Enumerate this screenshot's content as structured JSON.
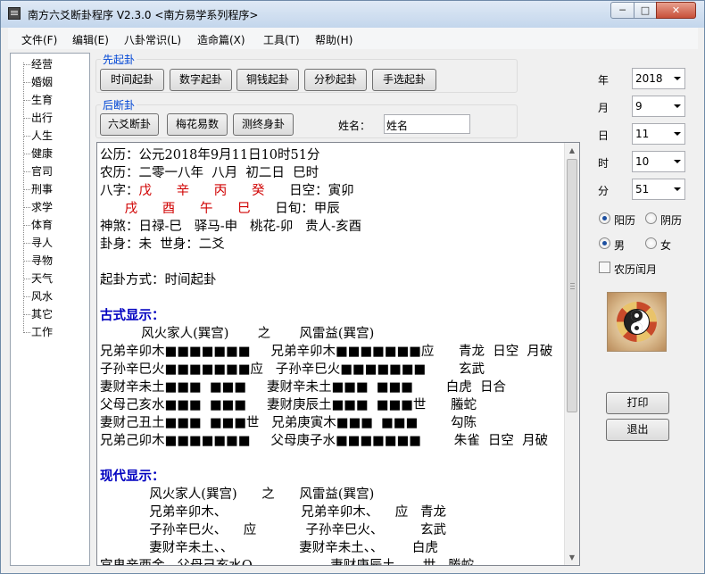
{
  "window": {
    "title": "南方六爻断卦程序 V2.3.0   <南方易学系列程序>"
  },
  "titlebar_buttons": {
    "minimize": "─",
    "maximize": "□",
    "close": "✕"
  },
  "menu": [
    "文件(F)",
    "编辑(E)",
    "八卦常识(L)",
    "造命篇(X)",
    "工具(T)",
    "帮助(H)"
  ],
  "sidebar": {
    "items": [
      "经营",
      "婚姻",
      "生育",
      "出行",
      "人生",
      "健康",
      "官司",
      "刑事",
      "求学",
      "体育",
      "寻人",
      "寻物",
      "天气",
      "风水",
      "其它",
      "工作"
    ]
  },
  "qigua": {
    "title": "先起卦",
    "buttons": [
      "时间起卦",
      "数字起卦",
      "铜钱起卦",
      "分秒起卦",
      "手选起卦"
    ]
  },
  "duangua": {
    "title": "后断卦",
    "buttons": [
      "六爻断卦",
      "梅花易数",
      "测终身卦"
    ],
    "name_label": "姓名：",
    "name_value": "姓名"
  },
  "output": {
    "lines": [
      {
        "segs": [
          {
            "t": "公历：公元2018年9月11日10时51分"
          }
        ]
      },
      {
        "segs": [
          {
            "t": "农历：二零一八年  八月  初二日  巳时"
          }
        ]
      },
      {
        "segs": [
          {
            "t": "八字："
          },
          {
            "t": "戊      辛      丙      癸",
            "c": "red"
          },
          {
            "t": "      日空：寅卯"
          }
        ]
      },
      {
        "segs": [
          {
            "t": "      "
          },
          {
            "t": "戌      酉      午      巳",
            "c": "red"
          },
          {
            "t": "      日旬：甲辰"
          }
        ]
      },
      {
        "segs": [
          {
            "t": "神煞：日禄-巳   驿马-申   桃花-卯   贵人-亥酉"
          }
        ]
      },
      {
        "segs": [
          {
            "t": "卦身：未  世身：二爻"
          }
        ]
      },
      {
        "segs": [
          {
            "t": ""
          }
        ]
      },
      {
        "segs": [
          {
            "t": "起卦方式：时间起卦"
          }
        ]
      },
      {
        "segs": [
          {
            "t": ""
          }
        ]
      },
      {
        "segs": [
          {
            "t": "古式显示：",
            "c": "blue-bold"
          }
        ]
      },
      {
        "segs": [
          {
            "t": "          风火家人(巽宫)       之       风雷益(巽宫)"
          }
        ]
      },
      {
        "segs": [
          {
            "t": "兄弟辛卯木■■■■■■■     兄弟辛卯木■■■■■■■应      青龙  日空  月破"
          }
        ]
      },
      {
        "segs": [
          {
            "t": "子孙辛巳火■■■■■■■应   子孙辛巳火■■■■■■■        玄武"
          }
        ]
      },
      {
        "segs": [
          {
            "t": "妻财辛未土■■■  ■■■     妻财辛未土■■■  ■■■        白虎  日合"
          }
        ]
      },
      {
        "segs": [
          {
            "t": "父母己亥水■■■  ■■■     妻财庚辰土■■■  ■■■世      螣蛇"
          }
        ]
      },
      {
        "segs": [
          {
            "t": "妻财己丑土■■■  ■■■世   兄弟庚寅木■■■  ■■■        勾陈"
          }
        ]
      },
      {
        "segs": [
          {
            "t": "兄弟己卯木■■■■■■■     父母庚子水■■■■■■■        朱雀  日空  月破"
          }
        ]
      },
      {
        "segs": [
          {
            "t": ""
          }
        ]
      },
      {
        "segs": [
          {
            "t": "现代显示：",
            "c": "blue-bold"
          }
        ]
      },
      {
        "segs": [
          {
            "t": "            风火家人(巽宫)      之      风雷益(巽宫)"
          }
        ]
      },
      {
        "segs": [
          {
            "t": "            兄弟辛卯木、                  兄弟辛卯木、    应   青龙"
          }
        ]
      },
      {
        "segs": [
          {
            "t": "            子孙辛巳火、    应            子孙辛巳火、         玄武"
          }
        ]
      },
      {
        "segs": [
          {
            "t": "            妻财辛未土、、                妻财辛未土、、       白虎"
          }
        ]
      },
      {
        "segs": [
          {
            "t": "宫鬼辛酉金   父母己亥水O                   妻财庚辰土、、  世   螣蛇"
          }
        ]
      }
    ]
  },
  "datetime": {
    "year": {
      "label": "年",
      "value": "2018"
    },
    "month": {
      "label": "月",
      "value": "9"
    },
    "day": {
      "label": "日",
      "value": "11"
    },
    "hour": {
      "label": "时",
      "value": "10"
    },
    "minute": {
      "label": "分",
      "value": "51"
    }
  },
  "calendar": {
    "solar": "阳历",
    "lunar": "阴历",
    "selected": "solar"
  },
  "gender": {
    "male": "男",
    "female": "女",
    "selected": "male"
  },
  "leap_month": {
    "label": "农历闰月",
    "checked": false
  },
  "actions": {
    "print": "打印",
    "exit": "退出"
  },
  "icons": {
    "app": "app-icon",
    "taiji": "taiji-icon"
  }
}
